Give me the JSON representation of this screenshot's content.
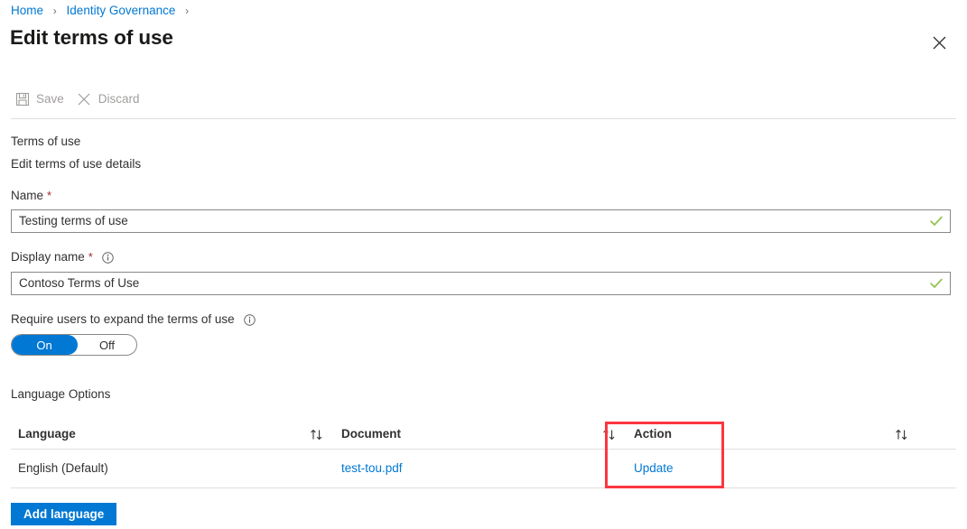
{
  "breadcrumb": {
    "items": [
      {
        "label": "Home"
      },
      {
        "label": "Identity Governance"
      }
    ],
    "separator": "›"
  },
  "header": {
    "title": "Edit terms of use",
    "close_icon": "close-icon"
  },
  "toolbar": {
    "save_label": "Save",
    "save_icon": "save-floppy-icon",
    "discard_label": "Discard",
    "discard_icon": "discard-x-icon"
  },
  "section": {
    "title": "Terms of use",
    "subtitle": "Edit terms of use details"
  },
  "fields": {
    "name": {
      "label": "Name",
      "required_mark": "*",
      "value": "Testing terms of use",
      "placeholder": "",
      "valid_icon": "checkmark-icon"
    },
    "display_name": {
      "label": "Display name",
      "required_mark": "*",
      "info_icon": "info-icon",
      "value": "Contoso Terms of Use",
      "placeholder": "",
      "valid_icon": "checkmark-icon"
    },
    "require_expand": {
      "label": "Require users to expand the terms of use",
      "info_icon": "info-icon",
      "on_label": "On",
      "off_label": "Off",
      "state": "On"
    }
  },
  "language_options": {
    "heading": "Language Options",
    "columns": {
      "language": "Language",
      "document": "Document",
      "action": "Action"
    },
    "sort_icon": "sort-ascending-descending-icon",
    "rows": [
      {
        "language": "English (Default)",
        "document": "test-tou.pdf",
        "action": "Update"
      }
    ]
  },
  "footer": {
    "add_language_label": "Add language"
  },
  "colors": {
    "accent": "#0078d4",
    "link": "#0078d4",
    "required": "#a4262c",
    "highlight": "#fb3640",
    "valid": "#92c353",
    "border": "#8a8886",
    "divider": "#e1dfdd"
  }
}
